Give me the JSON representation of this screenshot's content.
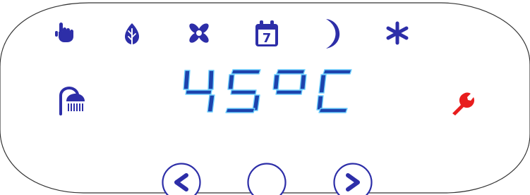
{
  "panel": {
    "top_icons": [
      {
        "name": "manual-mode-icon",
        "icon": "hand-pointer-icon"
      },
      {
        "name": "eco-mode-icon",
        "icon": "leaf-icon"
      },
      {
        "name": "fan-mode-icon",
        "icon": "fan-icon"
      },
      {
        "name": "schedule-icon",
        "icon": "calendar-icon",
        "text": "7"
      },
      {
        "name": "night-mode-icon",
        "icon": "moon-icon"
      },
      {
        "name": "frost-mode-icon",
        "icon": "snowflake-icon"
      }
    ],
    "left_icon": {
      "name": "shower-icon",
      "icon": "shower-icon"
    },
    "right_icon": {
      "name": "service-icon",
      "icon": "wrench-icon"
    },
    "display": {
      "value": "45",
      "unit": "°C"
    },
    "buttons": [
      {
        "name": "previous-button",
        "icon": "chevron-left-icon"
      },
      {
        "name": "center-button",
        "icon": "circle-button-icon"
      },
      {
        "name": "next-button",
        "icon": "chevron-right-icon"
      }
    ]
  },
  "colors": {
    "icon_blue": "#2d2ea8",
    "segment_blue": "#1d43ad",
    "segment_edge": "#6fd0ff",
    "frame": "#333333",
    "wrench_red": "#e81d1d"
  }
}
